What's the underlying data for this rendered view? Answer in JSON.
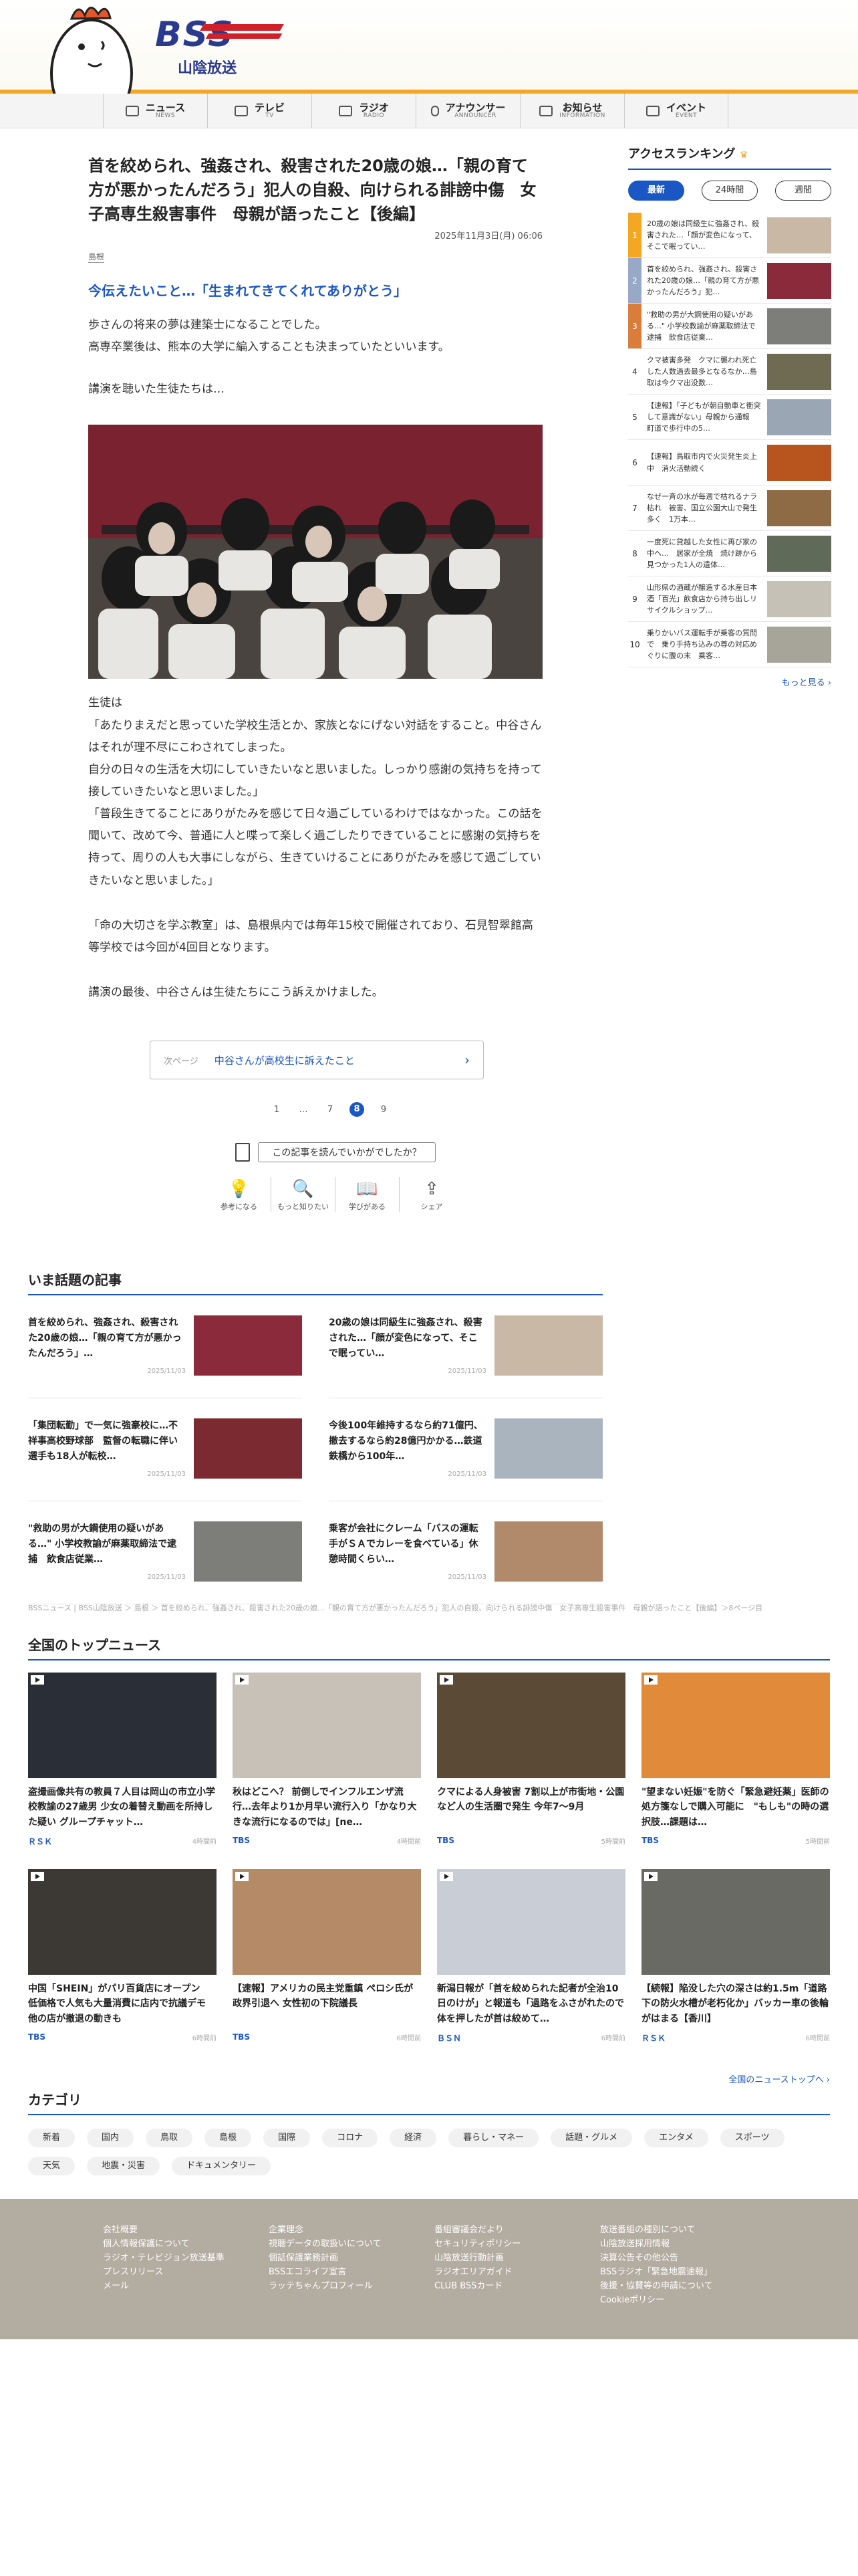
{
  "header": {
    "logo_text": "BSS",
    "station_name": "山陰放送"
  },
  "nav": [
    {
      "label": "ニュース",
      "sub": "NEWS"
    },
    {
      "label": "テレビ",
      "sub": "TV"
    },
    {
      "label": "ラジオ",
      "sub": "RADIO"
    },
    {
      "label": "アナウンサー",
      "sub": "ANNOUNCER"
    },
    {
      "label": "お知らせ",
      "sub": "INFORMATION"
    },
    {
      "label": "イベント",
      "sub": "EVENT"
    }
  ],
  "article": {
    "title": "首を絞められ、強姦され、殺害された20歳の娘…「親の育て方が悪かったんだろう」犯人の自殺、向けられる誹謗中傷　女子高専生殺害事件　母親が語ったこと【後編】",
    "date": "2025年11月3日(月) 06:06",
    "category": "島根",
    "subtitle": "今伝えたいこと…「生まれてきてくれてありがとう」",
    "p1": "歩さんの将来の夢は建築士になることでした。",
    "p2": "高専卒業後は、熊本の大学に編入することも決まっていたといいます。",
    "p3": "講演を聴いた生徒たちは…",
    "p4": "生徒は",
    "p5": "「あたりまえだと思っていた学校生活とか、家族となにげない対話をすること。中谷さんはそれが理不尽にこわされてしまった。",
    "p6": "自分の日々の生活を大切にしていきたいなと思いました。しっかり感謝の気持ちを持って接していきたいなと思いました。」",
    "p7": "「普段生きてることにありがたみを感じて日々過ごしているわけではなかった。この話を聞いて、改めて今、普通に人と喋って楽しく過ごしたりできていることに感謝の気持ちを持って、周りの人も大事にしながら、生きていけることにありがたみを感じて過ごしていきたいなと思いました。」",
    "p8": "「命の大切さを学ぶ教室」は、島根県内では毎年15校で開催されており、石見智翠館高等学校では今回が4回目となります。",
    "p9": "講演の最後、中谷さんは生徒たちにこう訴えかけました。",
    "next_label": "次ページ",
    "next_title": "中谷さんが高校生に訴えたこと",
    "pager": [
      "1",
      "…",
      "7",
      "8",
      "9"
    ],
    "feedback_q": "この記事を読んでいかがでしたか？",
    "feedback": [
      {
        "icon": "💡",
        "label": "参考になる"
      },
      {
        "icon": "🔍",
        "label": "もっと知りたい"
      },
      {
        "icon": "📖",
        "label": "学びがある"
      },
      {
        "icon": "⇪",
        "label": "シェア"
      }
    ]
  },
  "ranking": {
    "title": "アクセスランキング",
    "tabs": [
      "最新",
      "24時間",
      "週間"
    ],
    "items": [
      {
        "n": "1",
        "text": "20歳の娘は同級生に強姦され、殺害された…「顔が変色になって、そこで眠ってい…",
        "color": "#c9b8a6"
      },
      {
        "n": "2",
        "text": "首を絞められ、強姦され、殺害された20歳の娘…「親の育て方が悪かったんだろう」犯…",
        "color": "#8a2a3a"
      },
      {
        "n": "3",
        "text": "\"救助の男が大鋼使用の疑いがある…\" 小学校教諭が麻薬取締法で逮捕　飲食店従業…",
        "color": "#7d7d7a"
      },
      {
        "n": "4",
        "text": "クマ被害多発　クマに襲われ死亡した人数過去最多となるなか…島取は今クマ出没数…",
        "color": "#6f6a52"
      },
      {
        "n": "5",
        "text": "【速報】「子どもが朝自動車と衝突して意識がない」母親から通報　町道で歩行中の5…",
        "color": "#9aa6b4"
      },
      {
        "n": "6",
        "text": "【速報】鳥取市内で火災発生炎上中　消火活動続く",
        "color": "#b8541e"
      },
      {
        "n": "7",
        "text": "なぜ一斉の水が毎週で枯れるナラ枯れ　被害、国立公園大山で発生多く　1万本…",
        "color": "#8e6b45"
      },
      {
        "n": "8",
        "text": "一度死に貸越した女性に再び家の中へ…　居家が全焼　焼け跡から見つかった1人の遺体…",
        "color": "#5f6b58"
      },
      {
        "n": "9",
        "text": "山形県の酒蔵が醸造する水産日本酒「百光」飲食店から持ち出しリサイクルショップ…",
        "color": "#c5c1b6"
      },
      {
        "n": "10",
        "text": "乗りかいバス運転手が乗客の質問で　乗り手持ち込みの尊の対応めぐりに腹の末　乗客…",
        "color": "#a7a49a"
      }
    ],
    "more": "もっと見る ›"
  },
  "hot": {
    "title": "いま話題の記事",
    "items": [
      {
        "title": "首を絞められ、強姦され、殺害された20歳の娘…「親の育て方が悪かったんだろう」…",
        "date": "2025/11/03",
        "color": "#8a2a3a"
      },
      {
        "title": "20歳の娘は同級生に強姦され、殺害された…「顔が変色になって、そこで眠ってい…",
        "date": "2025/11/03",
        "color": "#c9b8a6"
      },
      {
        "title": "「集団転勤」で一気に強豪校に…不祥事高校野球部　監督の転職に伴い選手も18人が転校…",
        "date": "2025/11/03",
        "color": "#7a2a30"
      },
      {
        "title": "今後100年維持するなら約71億円、撤去するなら約28億円かかる…鉄道鉄橋から100年…",
        "date": "2025/11/03",
        "color": "#aab4be"
      },
      {
        "title": "\"救助の男が大鋼使用の疑いがある…\" 小学校教諭が麻薬取締法で逮捕　飲食店従業…",
        "date": "2025/11/03",
        "color": "#7d7d7a"
      },
      {
        "title": "乗客が会社にクレーム「バスの運転手がＳＡでカレーを食べている」休憩時間くらい…",
        "date": "2025/11/03",
        "color": "#b08a6a"
      }
    ]
  },
  "breadcrumb": "BSSニュース | BSS山陰放送 ＞ 島根 ＞ 首を絞められ、強姦され、殺害された20歳の娘…「親の育て方が悪かったんだろう」犯人の自殺、向けられる誹謗中傷　女子高専生殺害事件　母親が語ったこと【後編】＞8ページ目",
  "national": {
    "title": "全国のトップニュース",
    "items": [
      {
        "title": "盗撮画像共有の教員７人目は岡山の市立小学校教諭の27歳男 少女の着替え動画を所持した疑い グループチャット…",
        "src": "ＲＳＫ",
        "time": "4時間前",
        "color": "#2a2e36"
      },
      {
        "title": "秋はどこへ？ 前倒しでインフルエンザ流行…去年より1か月早い流行入り「かなり大きな流行になるのでは」[ne…",
        "src": "TBS",
        "time": "4時間前",
        "color": "#c7c1b8"
      },
      {
        "title": "クマによる人身被害 7割以上が市街地・公園など人の生活圏で発生 今年7～9月",
        "src": "TBS",
        "time": "5時間前",
        "color": "#5a4a36"
      },
      {
        "title": "\"望まない妊娠\"を防ぐ「緊急避妊薬」医師の処方箋なしで購入可能に　\"もしも\"の時の選択肢…課題は…",
        "src": "TBS",
        "time": "5時間前",
        "color": "#e08a3a"
      },
      {
        "title": "中国「SHEIN」がパリ百貨店にオープン　低価格で人気も大量消費に店内で抗議デモ 他の店が撤退の動きも",
        "src": "TBS",
        "time": "6時間前",
        "color": "#3c3834"
      },
      {
        "title": "【速報】アメリカの民主党重鎮 ペロシ氏が政界引退へ 女性初の下院議長",
        "src": "TBS",
        "time": "6時間前",
        "color": "#b58a66"
      },
      {
        "title": "新潟日報が「首を絞められた記者が全治10日のけが」と報道も「過路をふさがれたので体を押したが首は絞めて…",
        "src": "ＢＳＮ",
        "time": "6時間前",
        "color": "#c8cdd6"
      },
      {
        "title": "【続報】陥没した穴の深さは約1.5m「道路下の防火水槽が老朽化か」バッカー車の後輪がはまる【香川】",
        "src": "ＲＳＫ",
        "time": "6時間前",
        "color": "#6a6a64"
      }
    ],
    "more": "全国のニューストップへ ›"
  },
  "categories": {
    "title": "カテゴリ",
    "items": [
      "新着",
      "国内",
      "鳥取",
      "島根",
      "国際",
      "コロナ",
      "経済",
      "暮らし・マネー",
      "話題・グルメ",
      "エンタメ",
      "スポーツ",
      "天気",
      "地震・災害",
      "ドキュメンタリー"
    ]
  },
  "footer": {
    "col1": [
      "会社概要",
      "個人情報保護について",
      "ラジオ・テレビジョン放送基準",
      "プレスリリース",
      "メール"
    ],
    "col2": [
      "企業理念",
      "視聴データの取扱いについて",
      "個話保護業務計画",
      "BSSエコライフ宣言",
      "ラッテちゃんプロフィール"
    ],
    "col3": [
      "番組審議会だより",
      "セキュリティポリシー",
      "山陰放送行動計画",
      "ラジオエリアガイド",
      "CLUB BSSカード"
    ],
    "col4": [
      "放送番組の種別について",
      "山陰放送採用情報",
      "決算公告その他公告",
      "BSSラジオ「緊急地震速報」",
      "後援・協賛等の申請について",
      "Cookieポリシー"
    ]
  }
}
